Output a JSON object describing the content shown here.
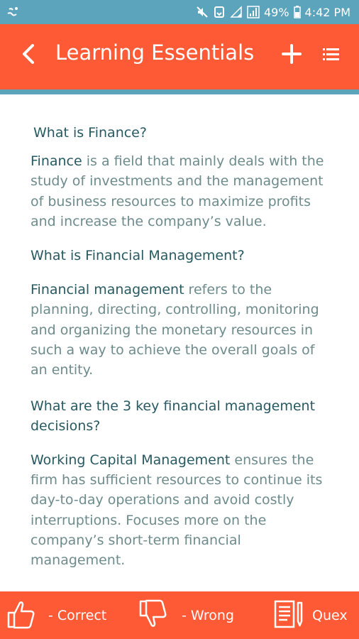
{
  "status_bar": {
    "battery": "49%",
    "time": "4:42 PM",
    "icons": [
      "notification-icon",
      "mute-icon",
      "data-saver-icon",
      "signal-icon",
      "battery-icon"
    ]
  },
  "app_bar": {
    "title": "Learning Essentials",
    "back_icon": "back-arrow-icon",
    "add_icon": "plus-icon",
    "menu_icon": "list-icon"
  },
  "content": {
    "sections": [
      {
        "question": "What is Finance?"
      },
      {
        "term": "Finance",
        "text": " is a field that mainly deals with the study of investments and the management of business resources to maximize profits and increase the company’s value."
      },
      {
        "question": "What is Financial Management?"
      },
      {
        "term": "Financial management",
        "text": " refers to the planning, directing, controlling, monitoring and organizing the monetary resources in such a way to achieve the overall goals of an entity."
      },
      {
        "question": "What are the 3 key financial management decisions?"
      },
      {
        "term": "Working Capital Management",
        "text": " ensures the firm has sufficient resources to continue its day-to-day operations and avoid costly interruptions. Focuses more on the company’s short-term financial management."
      }
    ]
  },
  "bottom_bar": {
    "correct_label": "- Correct",
    "wrong_label": "- Wrong",
    "quex_label": "Quex",
    "icons": [
      "thumbs-up-icon",
      "thumbs-down-icon",
      "notebook-icon"
    ]
  },
  "colors": {
    "status_bar": "#5ba4bb",
    "accent": "#ff5a36",
    "heading_text": "#275961",
    "body_text": "#6e8b8c"
  }
}
